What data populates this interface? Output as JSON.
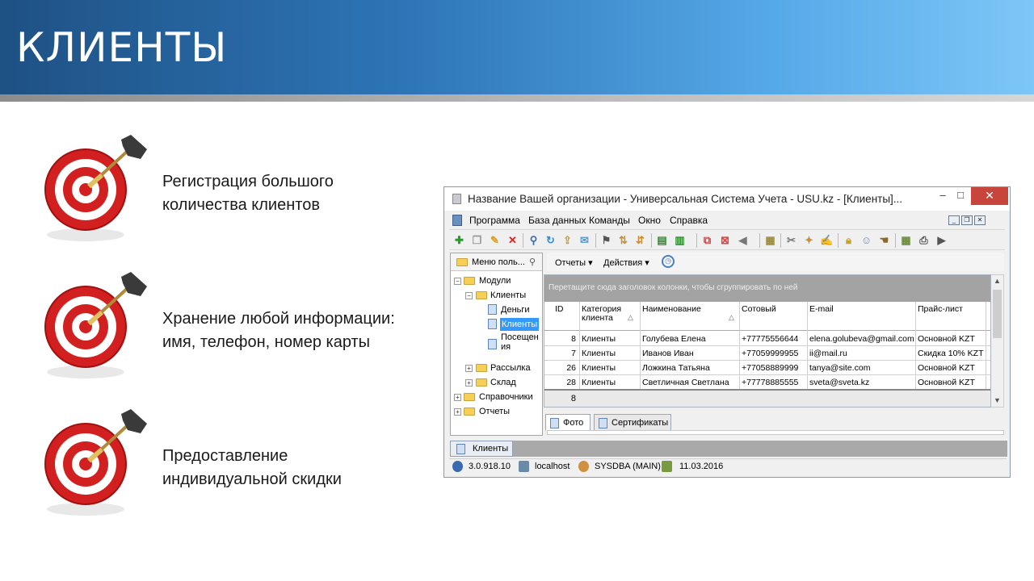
{
  "slide": {
    "title": "КЛИЕНТЫ",
    "bullets": [
      {
        "line1": "Регистрация большого",
        "line2": "количества клиентов"
      },
      {
        "line1": "Хранение любой информации:",
        "line2": "имя, телефон, номер карты"
      },
      {
        "line1": "Предоставление",
        "line2": "индивидуальной скидки"
      }
    ]
  },
  "window": {
    "title": "Название Вашей организации - Универсальная Система Учета - USU.kz - [Клиенты]...",
    "controls": {
      "minimize": "–",
      "maximize": "□",
      "close": "✕"
    },
    "menu": [
      "Программа",
      "База данных",
      "Команды",
      "Окно",
      "Справка"
    ],
    "left_panel": {
      "header": "Меню поль...",
      "tree": [
        {
          "label": "Модули",
          "level": 0,
          "expander": "−"
        },
        {
          "label": "Клиенты",
          "level": 1,
          "expander": "−"
        },
        {
          "label": "Деньги",
          "level": 2
        },
        {
          "label": "Клиенты",
          "level": 2,
          "selected": true
        },
        {
          "label": "Посещен",
          "label2": "ия",
          "level": 2
        },
        {
          "label": "Рассылка",
          "level": 1,
          "expander": "+"
        },
        {
          "label": "Склад",
          "level": 1,
          "expander": "+"
        },
        {
          "label": "Справочники",
          "level": 0,
          "expander": "+"
        },
        {
          "label": "Отчеты",
          "level": 0,
          "expander": "+"
        }
      ]
    },
    "subtoolbar": {
      "reports": "Отчеты",
      "actions": "Действия"
    },
    "grid": {
      "group_hint": "Перетащите сюда заголовок колонки, чтобы сгруппировать по ней",
      "columns": [
        {
          "line1": "ID",
          "line2": ""
        },
        {
          "line1": "Категория",
          "line2": "клиента"
        },
        {
          "line1": "Наименование",
          "line2": ""
        },
        {
          "line1": "Сотовый",
          "line2": ""
        },
        {
          "line1": "E-mail",
          "line2": ""
        },
        {
          "line1": "Прайс-лист",
          "line2": ""
        }
      ],
      "rows": [
        {
          "id": "8",
          "category": "Клиенты",
          "name": "Голубева Елена",
          "phone": "+77775556644",
          "email": "elena.golubeva@gmail.com",
          "price": "Основной KZT"
        },
        {
          "id": "7",
          "category": "Клиенты",
          "name": "Иванов Иван",
          "phone": "+77059999955",
          "email": "ii@mail.ru",
          "price": "Скидка 10% KZT"
        },
        {
          "id": "26",
          "category": "Клиенты",
          "name": "Ложкина Татьяна",
          "phone": "+77058889999",
          "email": "tanya@site.com",
          "price": "Основной KZT"
        },
        {
          "id": "28",
          "category": "Клиенты",
          "name": "Светличная Светлана",
          "phone": "+77778885555",
          "email": "sveta@sveta.kz",
          "price": "Основной KZT"
        }
      ],
      "footer_count": "8"
    },
    "detail_tabs": [
      "Фото",
      "Сертификаты"
    ],
    "bottom_tab": "Клиенты",
    "status": {
      "version": "3.0.918.10",
      "host": "localhost",
      "user": "SYSDBA (MAIN)",
      "date": "11.03.2016"
    }
  }
}
